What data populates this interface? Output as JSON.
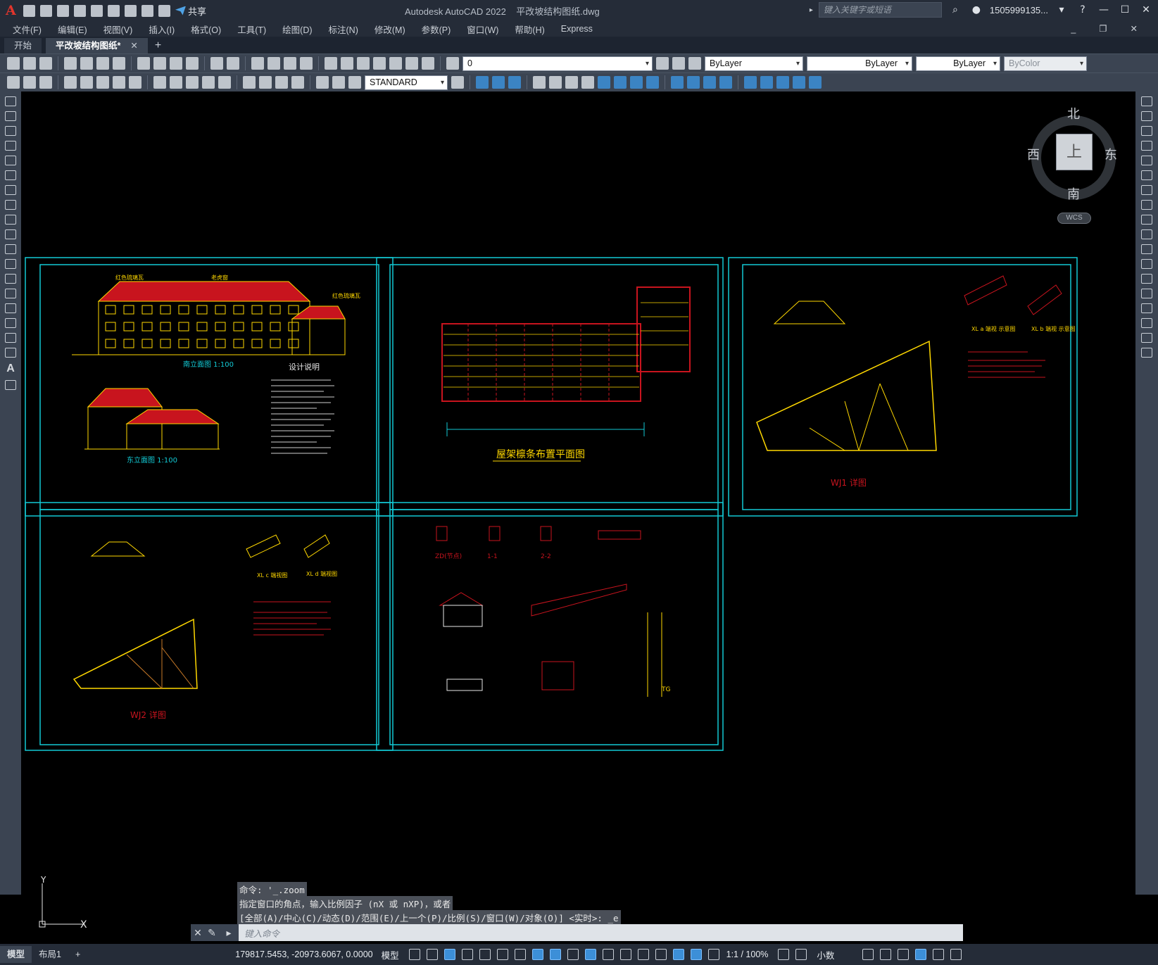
{
  "app": {
    "title": "Autodesk AutoCAD 2022",
    "filename": "平改坡结构图纸.dwg",
    "share_label": "共享"
  },
  "search": {
    "placeholder": "键入关键字或短语"
  },
  "user": {
    "name": "1505999135..."
  },
  "menu": [
    "文件(F)",
    "编辑(E)",
    "视图(V)",
    "插入(I)",
    "格式(O)",
    "工具(T)",
    "绘图(D)",
    "标注(N)",
    "修改(M)",
    "参数(P)",
    "窗口(W)",
    "帮助(H)",
    "Express"
  ],
  "tabs": [
    {
      "label": "开始"
    },
    {
      "label": "平改坡结构图纸*"
    }
  ],
  "toolbar": {
    "layer": "0",
    "color": "ByLayer",
    "linetype": "ByLayer",
    "lineweight": "ByLayer",
    "plotstyle": "ByColor",
    "textstyle": "STANDARD"
  },
  "viewcube": {
    "north": "北",
    "south": "南",
    "east": "东",
    "west": "西",
    "top": "上",
    "wcs": "WCS"
  },
  "drawings": {
    "s1_title1": "南立面图  1:100",
    "s1_title2": "东立面图  1:100",
    "s1_notes": "设计说明",
    "s1_lbl1": "红色琉璃瓦",
    "s1_lbl2": "老虎窗",
    "s1_lbl3": "红色琉璃瓦",
    "s2_title": "屋架檩条布置平面图",
    "s3_title": "WJ1 详图",
    "s3_a": "XL a 端视 示意图",
    "s3_b": "XL b 端视 示意图",
    "s4_title": "WJ2 详图",
    "s4_a": "XL c 端视图",
    "s4_b": "XL d 端视图",
    "s5_a": "ZD(节点)",
    "s5_b": "1-1",
    "s5_c": "2-2",
    "s5_d": "TG"
  },
  "ucs": {
    "x": "X",
    "y": "Y"
  },
  "command": {
    "history": [
      "命令: '_.zoom",
      "指定窗口的角点，输入比例因子 (nX 或 nXP)，或者",
      "[全部(A)/中心(C)/动态(D)/范围(E)/上一个(P)/比例(S)/窗口(W)/对象(O)] <实时>: _e"
    ],
    "placeholder": "键入命令"
  },
  "status": {
    "tab_model": "模型",
    "tab_layout": "布局1",
    "coords": "179817.5453, -20973.6067, 0.0000",
    "space": "模型",
    "scale": "1:1 / 100%",
    "units": "小数"
  }
}
